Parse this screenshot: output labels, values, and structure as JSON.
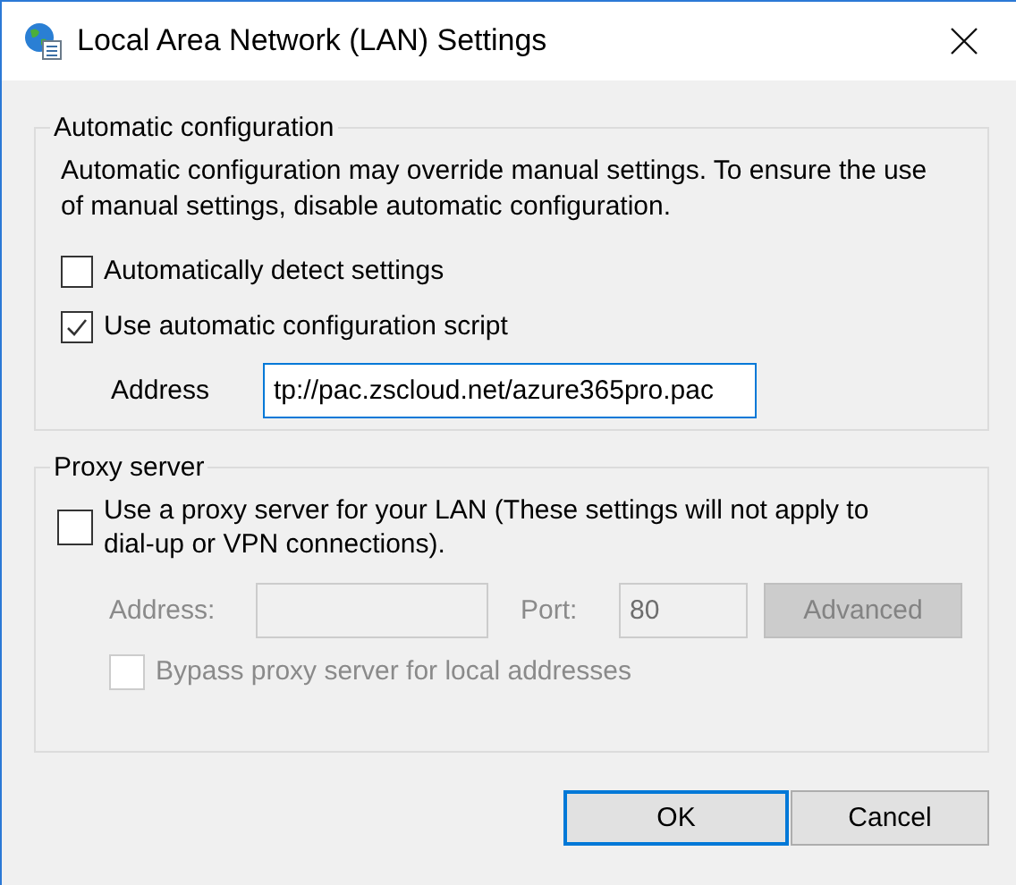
{
  "window": {
    "title": "Local Area Network (LAN) Settings"
  },
  "automatic_configuration": {
    "legend": "Automatic configuration",
    "description": "Automatic configuration may override manual settings.  To ensure the use of manual settings, disable automatic configuration.",
    "options": [
      {
        "label": "Automatically detect settings",
        "checked": false
      },
      {
        "label": "Use automatic configuration script",
        "checked": true
      }
    ],
    "address": {
      "label": "Address",
      "value": "tp://pac.zscloud.net/azure365pro.pac",
      "focused": true
    }
  },
  "proxy_server": {
    "legend": "Proxy server",
    "use_proxy": {
      "label": "Use a proxy server for your LAN (These settings will not apply to dial-up or VPN connections).",
      "checked": false
    },
    "address": {
      "label": "Address:",
      "disabled": true
    },
    "port": {
      "label": "Port:",
      "value": "80",
      "disabled": true
    },
    "advanced": {
      "label": "Advanced",
      "disabled": true
    },
    "bypass": {
      "label": "Bypass proxy server for local addresses",
      "checked": false,
      "disabled": true
    }
  },
  "buttons": [
    {
      "label": "OK",
      "default": true
    },
    {
      "label": "Cancel",
      "default": false
    }
  ]
}
